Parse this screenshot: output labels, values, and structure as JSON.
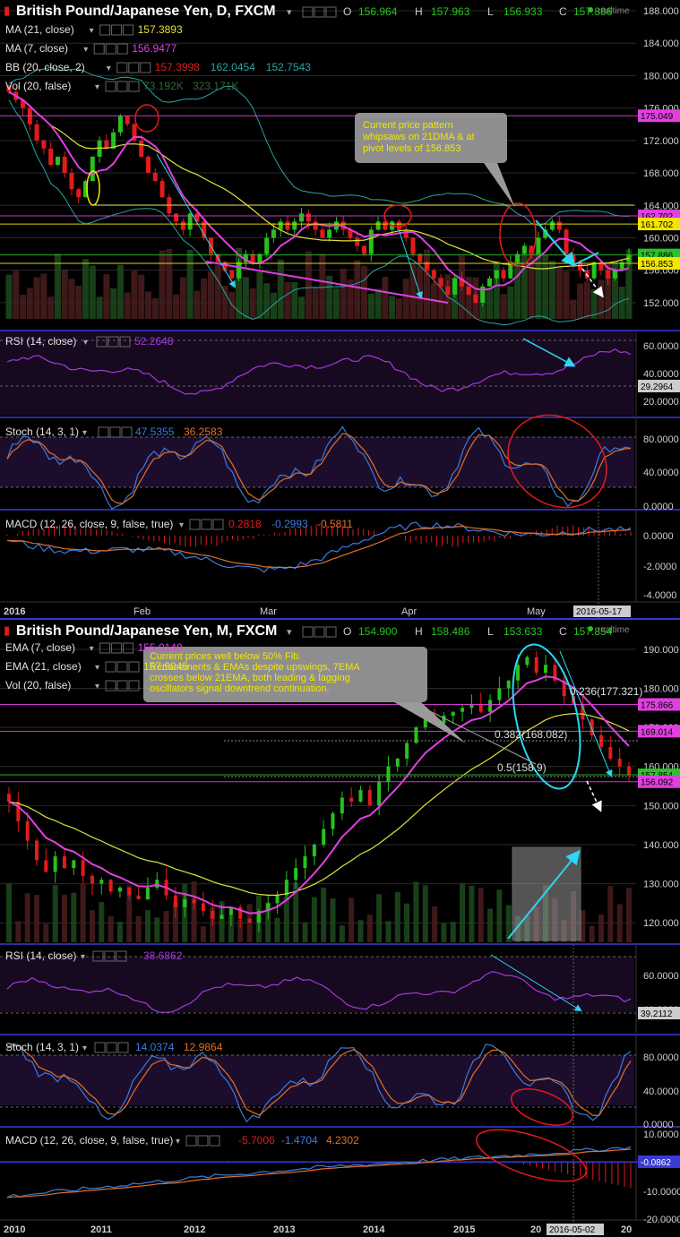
{
  "colors": {
    "bg": "#000000",
    "up": "#26c21e",
    "down": "#e31b1b",
    "grid": "#2a2a2a",
    "border": "#3a3ad6",
    "ma21": "#e0e23a",
    "ma7": "#e040e0",
    "bb": "#2aa3a3",
    "cyan": "#2ad7f5",
    "purple": "#a33ae0",
    "stochK": "#3a7be0",
    "stochD": "#e0702a",
    "vol": "#2f6a2f",
    "macd": "#3a7be0",
    "signal": "#e0702a",
    "hist": "#e31b1b",
    "fib": "#e040e0"
  },
  "top": {
    "title": "British Pound/Japanese Yen, D, FXCM",
    "ohlc": {
      "o_label": "O",
      "o": "156.964",
      "h_label": "H",
      "h": "157.963",
      "l_label": "L",
      "l": "156.933",
      "c_label": "C",
      "c": "157.886"
    },
    "realtime": "realtime",
    "legends": [
      {
        "name": "MA (21, close)",
        "values": [
          "157.3893"
        ],
        "colors": [
          "#e0e23a"
        ]
      },
      {
        "name": "MA (7, close)",
        "values": [
          "156.9477"
        ],
        "colors": [
          "#e040e0"
        ]
      },
      {
        "name": "BB (20, close, 2)",
        "values": [
          "157.3998",
          "162.0454",
          "152.7543"
        ],
        "colors": [
          "#e31b1b",
          "#2aa3a3",
          "#2aa3a3"
        ]
      },
      {
        "name": "Vol (20, false)",
        "values": [
          "73.192K",
          "323.171K"
        ],
        "colors": [
          "#2f6a2f",
          "#2f6a2f"
        ]
      }
    ],
    "annotation": "Current price pattern whipsaws on 21DMA & at pivot levels of 156.853",
    "price_axis": [
      "188.000",
      "184.000",
      "180.000",
      "176.000",
      "172.000",
      "168.000",
      "164.000",
      "160.000",
      "156.000",
      "152.000"
    ],
    "level_tags": [
      {
        "text": "175.049",
        "bg": "#e040e0",
        "fg": "#000000"
      },
      {
        "text": "162.702",
        "bg": "#e040e0",
        "fg": "#000000"
      },
      {
        "text": "161.702",
        "bg": "#f2e600",
        "fg": "#000000"
      },
      {
        "text": "157.886",
        "bg": "#2ac22a",
        "fg": "#000000"
      },
      {
        "text": "156.853",
        "bg": "#f2e600",
        "fg": "#000000"
      }
    ],
    "x_labels": [
      "2016",
      "Feb",
      "Mar",
      "Apr",
      "May",
      "2016-05-17"
    ],
    "rsi": {
      "label": "RSI (14, close)",
      "value": "52.2648",
      "axis": [
        "60.0000",
        "40.0000",
        "20.0000"
      ],
      "tag": "29.2964"
    },
    "stoch": {
      "label": "Stoch (14, 3, 1)",
      "k": "47.5355",
      "d": "36.2583",
      "axis": [
        "80.0000",
        "40.0000",
        "0.0000"
      ]
    },
    "macd": {
      "label": "MACD (12, 26, close, 9, false, true)",
      "v1": "0.2818",
      "v2": "-0.2993",
      "v3": "-0.5811",
      "axis": [
        "0.0000",
        "-2.0000",
        "-4.0000"
      ]
    }
  },
  "bottom": {
    "title": "British Pound/Japanese Yen, M, FXCM",
    "ohlc": {
      "o_label": "O",
      "o": "154.900",
      "h_label": "H",
      "h": "158.486",
      "l_label": "L",
      "l": "153.633",
      "c_label": "C",
      "c": "157.854"
    },
    "realtime": "realtime",
    "legends": [
      {
        "name": "EMA (7, close)",
        "values": [
          "155.0148"
        ],
        "colors": [
          "#e040e0"
        ]
      },
      {
        "name": "EMA (21, close)",
        "values": [
          "157.9845"
        ],
        "colors": [
          "#e0e23a"
        ]
      },
      {
        "name": "Vol (20, false)",
        "values": [],
        "colors": []
      }
    ],
    "annotation": "Current prices well below 50% Fib. Retracements & EMAs despite upswings, 7EMA crosses below 21EMA, both leading & lagging oscillators signal downtrend continuation.",
    "fib_labels": [
      "0.236(177.321)",
      "0.382(168.082)",
      "0.5(158.9)"
    ],
    "price_axis": [
      "190.000",
      "180.000",
      "170.000",
      "160.000",
      "150.000",
      "140.000",
      "130.000",
      "120.000"
    ],
    "level_tags": [
      {
        "text": "175.866",
        "bg": "#e040e0",
        "fg": "#000000"
      },
      {
        "text": "169.014",
        "bg": "#e040e0",
        "fg": "#000000"
      },
      {
        "text": "157.854",
        "bg": "#2ac22a",
        "fg": "#000000"
      },
      {
        "text": "156.092",
        "bg": "#e040e0",
        "fg": "#000000"
      }
    ],
    "x_labels": [
      "2010",
      "2011",
      "2012",
      "2013",
      "2014",
      "2015",
      "20",
      "2016-05-02",
      "20"
    ],
    "rsi": {
      "label": "RSI (14, close)",
      "value": "38.6862",
      "axis": [
        "60.0000",
        "40.0000"
      ],
      "tag": "39.2112"
    },
    "stoch": {
      "label": "Stoch (14, 3, 1)",
      "k": "14.0374",
      "d": "12.9864",
      "axis": [
        "80.0000",
        "40.0000",
        "0.0000"
      ]
    },
    "macd": {
      "label": "MACD (12, 26, close, 9, false, true)",
      "v1": "-5.7006",
      "v2": "-1.4704",
      "v3": "4.2302",
      "axis": [
        "10.0000",
        "0.0000",
        "-10.0000",
        "-20.0000"
      ],
      "tag": "-0.0862"
    }
  },
  "chart_data": [
    {
      "type": "candlestick",
      "title": "British Pound/Japanese Yen, D, FXCM",
      "ylim": [
        150,
        188
      ],
      "x_labels": [
        "2016",
        "Feb",
        "Mar",
        "Apr",
        "May",
        "2016-05-17"
      ],
      "close": [
        178,
        177,
        176,
        174,
        172,
        171,
        169,
        170,
        168,
        166,
        165,
        167,
        170,
        172,
        171,
        173,
        175,
        174,
        172,
        170,
        168,
        167,
        165,
        163,
        162,
        161,
        163,
        162,
        160,
        158,
        157,
        156,
        155,
        157,
        158,
        157,
        158,
        160,
        161,
        162,
        161,
        162,
        163,
        162,
        161,
        160,
        161,
        162,
        161,
        160,
        159,
        158,
        161,
        162,
        161,
        162,
        161,
        160,
        158,
        157,
        156,
        155,
        154,
        153,
        155,
        154,
        153,
        152,
        154,
        155,
        156,
        155,
        157,
        158,
        159,
        158,
        160,
        161,
        162,
        161,
        158,
        157,
        156,
        155,
        157,
        156,
        155,
        156,
        157,
        157.886
      ],
      "ma21_last": 157.3893,
      "ma7_last": 156.9477,
      "bb": [
        157.3998,
        162.0454,
        152.7543
      ],
      "levels": [
        175.049,
        162.702,
        161.702,
        157.886,
        156.853
      ]
    },
    {
      "type": "candlestick",
      "title": "British Pound/Japanese Yen, M, FXCM",
      "ylim": [
        115,
        195
      ],
      "x_labels": [
        "2010",
        "2011",
        "2012",
        "2013",
        "2014",
        "2015",
        "20",
        "2016-05-02",
        "20"
      ],
      "close": [
        151,
        146,
        141,
        136,
        133,
        137,
        134,
        136,
        132,
        130,
        131,
        128,
        129,
        127,
        126,
        129,
        131,
        127,
        124,
        126,
        125,
        123,
        121,
        122,
        124,
        121,
        120,
        123,
        125,
        127,
        131,
        134,
        137,
        140,
        144,
        148,
        152,
        151,
        154,
        150,
        156,
        160,
        162,
        166,
        170,
        172,
        171,
        173,
        174,
        175,
        176,
        174,
        177,
        180,
        182,
        186,
        188,
        184,
        186,
        182,
        178,
        176,
        172,
        168,
        165,
        162,
        160,
        157.854
      ],
      "ema7_last": 155.0148,
      "ema21_last": 157.9845,
      "fib": [
        {
          "level": 0.236,
          "price": 177.321
        },
        {
          "level": 0.382,
          "price": 168.082
        },
        {
          "level": 0.5,
          "price": 158.9
        }
      ],
      "levels": [
        175.866,
        169.014,
        157.854,
        156.092
      ]
    }
  ]
}
